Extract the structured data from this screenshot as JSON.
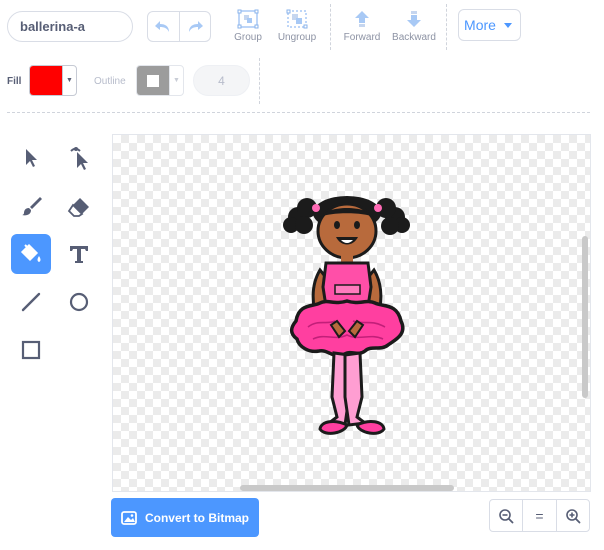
{
  "costume": {
    "name": "ballerina-a"
  },
  "toolbar": {
    "group_label": "Group",
    "ungroup_label": "Ungroup",
    "forward_label": "Forward",
    "backward_label": "Backward",
    "more_label": "More"
  },
  "fill": {
    "label": "Fill",
    "color": "#ff0000"
  },
  "outline": {
    "label": "Outline",
    "stroke_width": "4"
  },
  "tools": [
    {
      "icon": "select-arrow-icon",
      "active": false
    },
    {
      "icon": "reshape-icon",
      "active": false
    },
    {
      "icon": "brush-icon",
      "active": false
    },
    {
      "icon": "eraser-icon",
      "active": false
    },
    {
      "icon": "fill-bucket-icon",
      "active": true
    },
    {
      "icon": "text-icon",
      "active": false
    },
    {
      "icon": "line-icon",
      "active": false
    },
    {
      "icon": "circle-icon",
      "active": false
    },
    {
      "icon": "rectangle-icon",
      "active": false
    }
  ],
  "convert": {
    "label": "Convert to Bitmap"
  },
  "zoom": {
    "reset_label": "="
  },
  "colors": {
    "accent": "#4c97ff",
    "text": "#575e75",
    "fill": "#ff0000"
  }
}
